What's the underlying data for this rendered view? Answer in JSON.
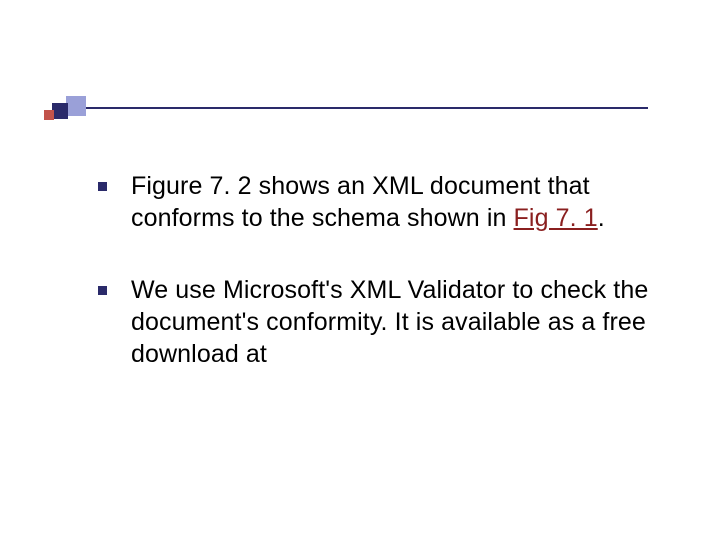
{
  "items": [
    {
      "pre": "Figure 7. 2 shows an XML document that conforms to the schema shown in ",
      "link": "Fig 7. 1",
      "post": "."
    },
    {
      "pre": "We use Microsoft's XML Validator to check the document's conformity. It is available as a free download at",
      "link": "",
      "post": ""
    }
  ]
}
